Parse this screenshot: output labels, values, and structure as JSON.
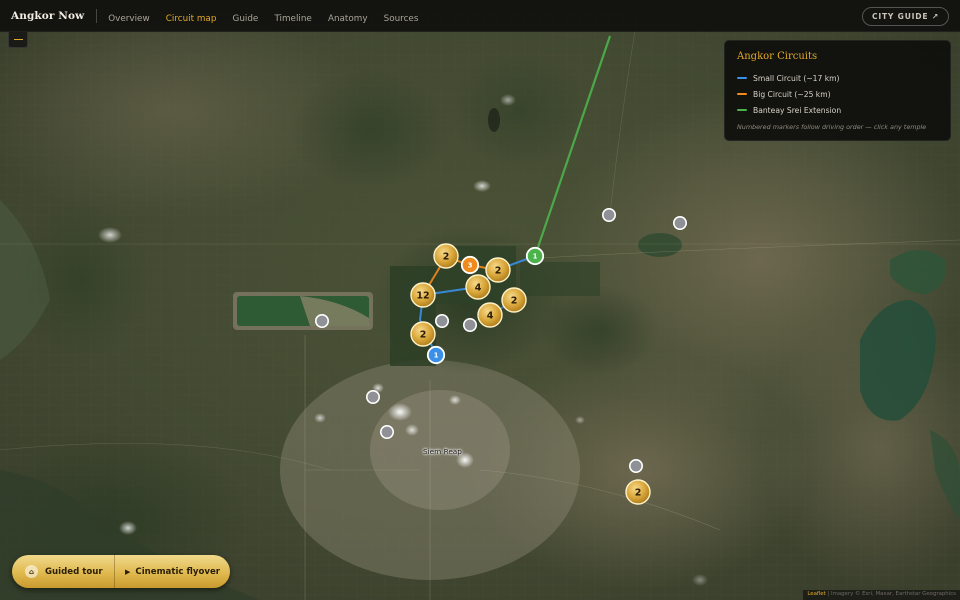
{
  "app": {
    "brand": "Angkor Now"
  },
  "nav": {
    "items": [
      {
        "label": "Overview",
        "active": false
      },
      {
        "label": "Circuit map",
        "active": true
      },
      {
        "label": "Guide",
        "active": false
      },
      {
        "label": "Timeline",
        "active": false
      },
      {
        "label": "Anatomy",
        "active": false
      },
      {
        "label": "Sources",
        "active": false
      }
    ],
    "city_guide": "CITY GUIDE ↗"
  },
  "legend": {
    "title": "Angkor Circuits",
    "items": [
      {
        "label": "Small Circuit (~17 km)",
        "color": "#3a8fe8"
      },
      {
        "label": "Big Circuit (~25 km)",
        "color": "#f08a1c"
      },
      {
        "label": "Banteay Srei Extension",
        "color": "#4cb24c"
      }
    ],
    "note": "Numbered markers follow driving order — click any temple"
  },
  "map": {
    "city_label": "Siem Reap",
    "cluster_markers": [
      "2",
      "2",
      "12",
      "4",
      "2",
      "4",
      "2",
      "2"
    ],
    "numbered_stops": [
      {
        "label": "1",
        "circuit": "Small Circuit",
        "color": "#3a8fe8"
      },
      {
        "label": "3",
        "circuit": "Big Circuit",
        "color": "#f08a1c"
      },
      {
        "label": "1",
        "circuit": "Banteay Srei Extension",
        "color": "#4cb24c"
      }
    ],
    "temple_dot_count": 8
  },
  "tour": {
    "guided_label": "Guided tour",
    "flyover_label": "Cinematic flyover"
  },
  "attribution": {
    "leaflet": "Leaflet",
    "imagery": "| Imagery © Esri, Maxar, Earthstar Geographics"
  }
}
